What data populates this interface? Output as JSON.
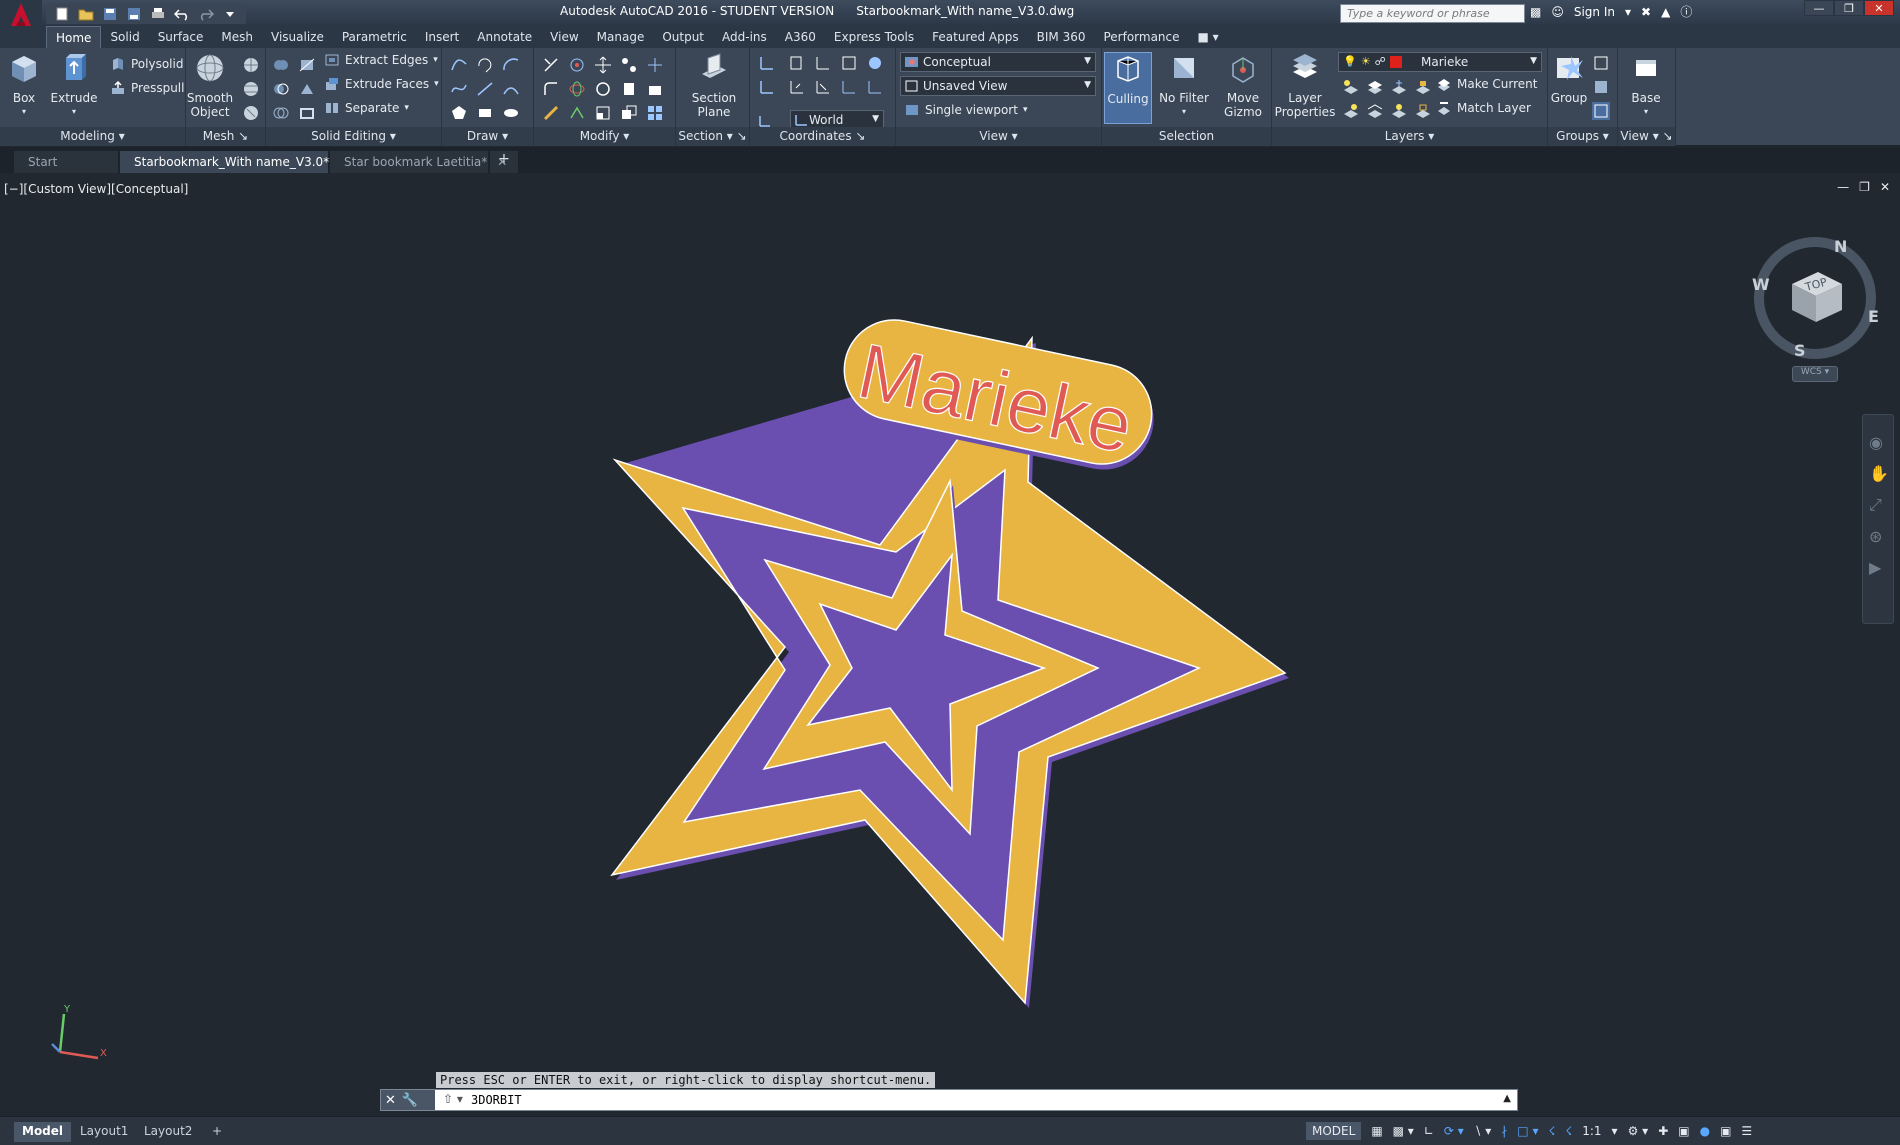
{
  "window": {
    "app_title": "Autodesk AutoCAD 2016 - STUDENT VERSION",
    "file_title": "Starbookmark_With name_V3.0.dwg",
    "search_placeholder": "Type a keyword or phrase",
    "sign_in": "Sign In"
  },
  "ribbon_tabs": [
    "Home",
    "Solid",
    "Surface",
    "Mesh",
    "Visualize",
    "Parametric",
    "Insert",
    "Annotate",
    "View",
    "Manage",
    "Output",
    "Add-ins",
    "A360",
    "Express Tools",
    "Featured Apps",
    "BIM 360",
    "Performance"
  ],
  "panels": {
    "modeling": {
      "title": "Modeling",
      "box": "Box",
      "extrude": "Extrude",
      "polysolid": "Polysolid",
      "presspull": "Presspull"
    },
    "mesh": {
      "title": "Mesh",
      "smooth1": "Smooth",
      "smooth2": "Object"
    },
    "solid_editing": {
      "title": "Solid Editing",
      "extract_edges": "Extract Edges",
      "extrude_faces": "Extrude Faces",
      "separate": "Separate"
    },
    "draw": {
      "title": "Draw"
    },
    "modify": {
      "title": "Modify"
    },
    "section": {
      "title": "Section",
      "btn1": "Section",
      "btn2": "Plane"
    },
    "coordinates": {
      "title": "Coordinates",
      "world": "World"
    },
    "view": {
      "title": "View",
      "visual_style": "Conceptual",
      "saved_view": "Unsaved View",
      "viewport": "Single viewport"
    },
    "selection": {
      "title": "Selection",
      "culling": "Culling",
      "no_filter": "No Filter",
      "move1": "Move",
      "move2": "Gizmo"
    },
    "layers": {
      "title": "Layers",
      "props1": "Layer",
      "props2": "Properties",
      "current_layer": "Marieke",
      "make_current": "Make Current",
      "match_layer": "Match Layer",
      "layer_color": "#e0201a"
    },
    "groups": {
      "title": "Groups",
      "group": "Group"
    },
    "view2": {
      "title": "View",
      "base": "Base"
    }
  },
  "file_tabs": [
    {
      "label": "Start"
    },
    {
      "label": "Starbookmark_With name_V3.0*"
    },
    {
      "label": "Star bookmark Laetitia*"
    }
  ],
  "viewport": {
    "label": "[−][Custom View][Conceptual]",
    "model_text": "Marieke",
    "model_color": "#e8b543",
    "text_color": "#e05a55",
    "viewcube": {
      "top": "TOP",
      "n": "N",
      "s": "S",
      "e": "E",
      "w": "W",
      "wcs": "WCS"
    }
  },
  "command": {
    "history": "Press ESC or ENTER to exit, or right-click to display shortcut-menu.",
    "current": "3DORBIT"
  },
  "status": {
    "layouts": [
      "Model",
      "Layout1",
      "Layout2"
    ],
    "model_btn": "MODEL",
    "scale": "1:1"
  }
}
